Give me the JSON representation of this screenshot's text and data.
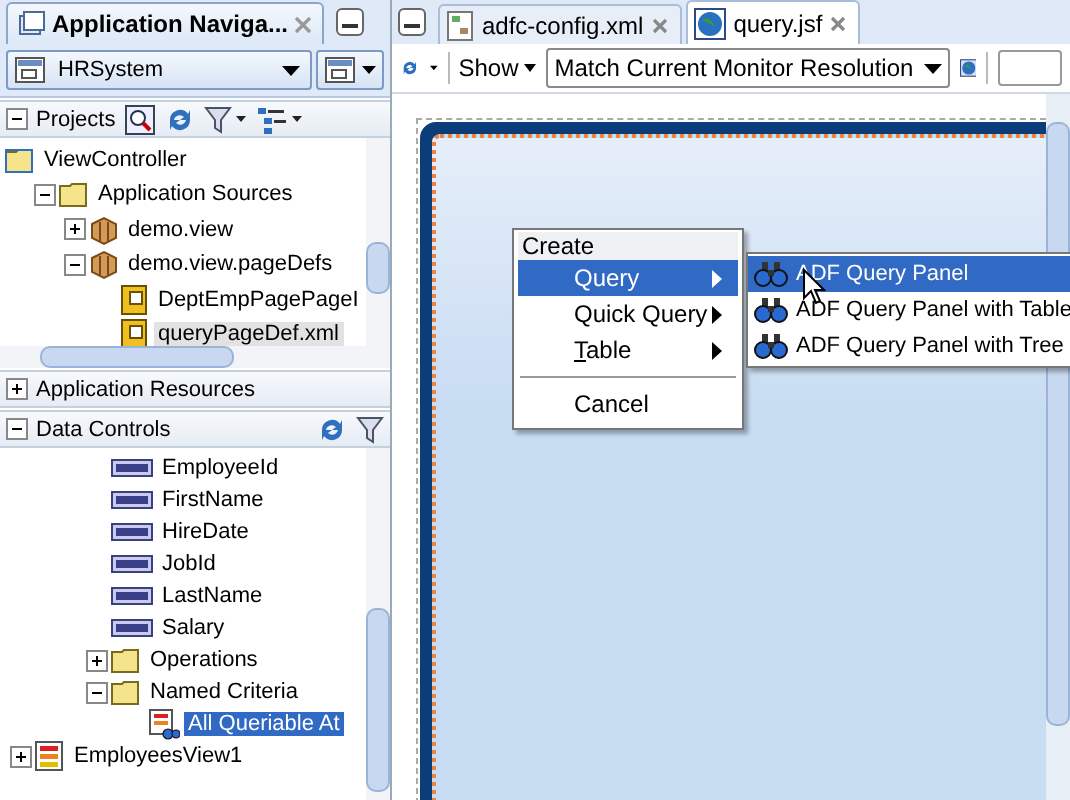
{
  "navigator": {
    "title": "Application Naviga...",
    "project": "HRSystem",
    "projects_section": {
      "label": "Projects",
      "expanded": true
    },
    "projects_tree": [
      {
        "label": "ViewController",
        "kind": "project",
        "selected": false,
        "children": [
          {
            "label": "Application Sources",
            "kind": "folder",
            "expanded": true,
            "selected": false,
            "children": [
              {
                "label": "demo.view",
                "kind": "package",
                "expanded": false,
                "selected": false
              },
              {
                "label": "demo.view.pageDefs",
                "kind": "package",
                "expanded": true,
                "selected": false,
                "children": [
                  {
                    "label": "DeptEmpPagePageI",
                    "kind": "pagedef",
                    "selected": false
                  },
                  {
                    "label": "queryPageDef.xml",
                    "kind": "pagedef",
                    "selected": true
                  }
                ]
              }
            ]
          }
        ]
      }
    ],
    "resources_section": {
      "label": "Application Resources",
      "expanded": false
    },
    "data_controls_section": {
      "label": "Data Controls",
      "expanded": true
    },
    "data_controls_items": [
      {
        "label": "EmployeeId",
        "kind": "attribute",
        "selected": false
      },
      {
        "label": "FirstName",
        "kind": "attribute",
        "selected": false
      },
      {
        "label": "HireDate",
        "kind": "attribute",
        "selected": false
      },
      {
        "label": "JobId",
        "kind": "attribute",
        "selected": false
      },
      {
        "label": "LastName",
        "kind": "attribute",
        "selected": false
      },
      {
        "label": "Salary",
        "kind": "attribute",
        "selected": false
      },
      {
        "label": "Operations",
        "kind": "folder",
        "expanded": false,
        "selected": false
      },
      {
        "label": "Named Criteria",
        "kind": "folder",
        "expanded": true,
        "selected": false,
        "children": [
          {
            "label": "All Queriable At",
            "kind": "criteria",
            "selected": true
          }
        ]
      }
    ],
    "data_controls_more": [
      {
        "label": "EmployeesView1",
        "kind": "view",
        "expanded": false,
        "selected": false
      }
    ]
  },
  "editor": {
    "tabs": [
      {
        "label": "adfc-config.xml",
        "kind": "xml",
        "selected": false
      },
      {
        "label": "query.jsf",
        "kind": "jsf",
        "selected": true
      }
    ],
    "show_label": "Show",
    "resolution": "Match Current Monitor Resolution"
  },
  "context_menu": {
    "header": "Create",
    "items": [
      {
        "kind": "item",
        "label": "Query",
        "submenu": true,
        "selected": true
      },
      {
        "kind": "item",
        "label": "Quick Query",
        "submenu": true,
        "selected": false
      },
      {
        "kind": "item",
        "label": "Table",
        "submenu": true,
        "mnemonic": true,
        "selected": false
      },
      {
        "kind": "separator"
      },
      {
        "kind": "item",
        "label": "Cancel",
        "submenu": false,
        "selected": false
      }
    ],
    "submenu": [
      {
        "label": "ADF Query Panel",
        "selected": true
      },
      {
        "label": "ADF Query Panel with Table",
        "selected": false
      },
      {
        "label": "ADF Query Panel with Tree",
        "selected": false
      }
    ]
  }
}
